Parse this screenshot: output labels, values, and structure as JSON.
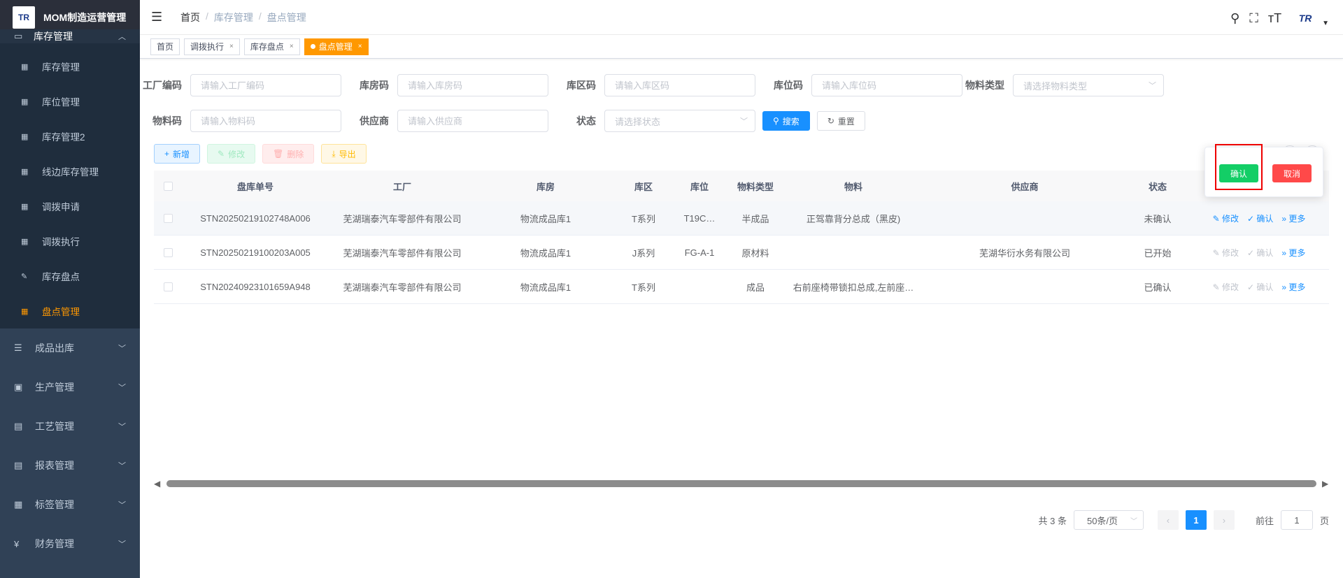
{
  "app": {
    "title": "MOM制造运营管理",
    "logo_text": "TR"
  },
  "sidebar": {
    "open_group": "库存管理",
    "sub_items": [
      {
        "label": "库存管理",
        "icon": "grid-icon"
      },
      {
        "label": "库位管理",
        "icon": "grid-icon"
      },
      {
        "label": "库存管理2",
        "icon": "grid-icon"
      },
      {
        "label": "线边库存管理",
        "icon": "grid-icon"
      },
      {
        "label": "调拨申请",
        "icon": "grid-icon"
      },
      {
        "label": "调拨执行",
        "icon": "grid-icon"
      },
      {
        "label": "库存盘点",
        "icon": "edit-icon"
      },
      {
        "label": "盘点管理",
        "icon": "grid-icon"
      }
    ],
    "groups": [
      {
        "label": "成品出库",
        "icon": "list-icon"
      },
      {
        "label": "生产管理",
        "icon": "monitor-icon"
      },
      {
        "label": "工艺管理",
        "icon": "printer-icon"
      },
      {
        "label": "报表管理",
        "icon": "printer-icon"
      },
      {
        "label": "标签管理",
        "icon": "grid-icon"
      },
      {
        "label": "财务管理",
        "icon": "yen-icon"
      }
    ]
  },
  "breadcrumb": {
    "home": "首页",
    "level1": "库存管理",
    "level2": "盘点管理",
    "sep": "/"
  },
  "tags": [
    {
      "label": "首页",
      "closable": false
    },
    {
      "label": "调拨执行",
      "closable": true
    },
    {
      "label": "库存盘点",
      "closable": true
    },
    {
      "label": "盘点管理",
      "closable": true,
      "active": true
    }
  ],
  "filters": {
    "factory": {
      "label": "工厂编码",
      "placeholder": "请输入工厂编码"
    },
    "warehouse": {
      "label": "库房码",
      "placeholder": "请输入库房码"
    },
    "area": {
      "label": "库区码",
      "placeholder": "请输入库区码"
    },
    "location": {
      "label": "库位码",
      "placeholder": "请输入库位码"
    },
    "material_type": {
      "label": "物料类型",
      "placeholder": "请选择物料类型"
    },
    "material": {
      "label": "物料码",
      "placeholder": "请输入物料码"
    },
    "supplier": {
      "label": "供应商",
      "placeholder": "请输入供应商"
    },
    "status": {
      "label": "状态",
      "placeholder": "请选择状态"
    },
    "search_label": "搜索",
    "reset_label": "重置"
  },
  "toolbar": {
    "add": "新增",
    "edit": "修改",
    "delete": "删除",
    "export": "导出"
  },
  "table": {
    "headers": [
      "盘库单号",
      "工厂",
      "库房",
      "库区",
      "库位",
      "物料类型",
      "物料",
      "供应商",
      "状态"
    ],
    "rows": [
      [
        "STN20250219102748A006",
        "芜湖瑞泰汽车零部件有限公司",
        "物流成品库1",
        "T系列",
        "T19C…",
        "半成品",
        "正驾靠背分总成（黑皮)",
        "",
        "未确认"
      ],
      [
        "STN20250219100203A005",
        "芜湖瑞泰汽车零部件有限公司",
        "物流成品库1",
        "J系列",
        "FG-A-1",
        "原材料",
        "",
        "芜湖华衍水务有限公司",
        "已开始"
      ],
      [
        "STN20240923101659A948",
        "芜湖瑞泰汽车零部件有限公司",
        "物流成品库1",
        "T系列",
        "",
        "成品",
        "右前座椅带锁扣总成,左前座…",
        "",
        "已确认"
      ]
    ],
    "op_edit": "修改",
    "op_confirm": "确认",
    "op_more": "更多"
  },
  "pagination": {
    "total": "共 3 条",
    "page_size": "50条/页",
    "current": "1",
    "goto": "前往",
    "goto_value": "1",
    "page_unit": "页"
  },
  "popover": {
    "confirm": "确认",
    "cancel": "取消"
  }
}
